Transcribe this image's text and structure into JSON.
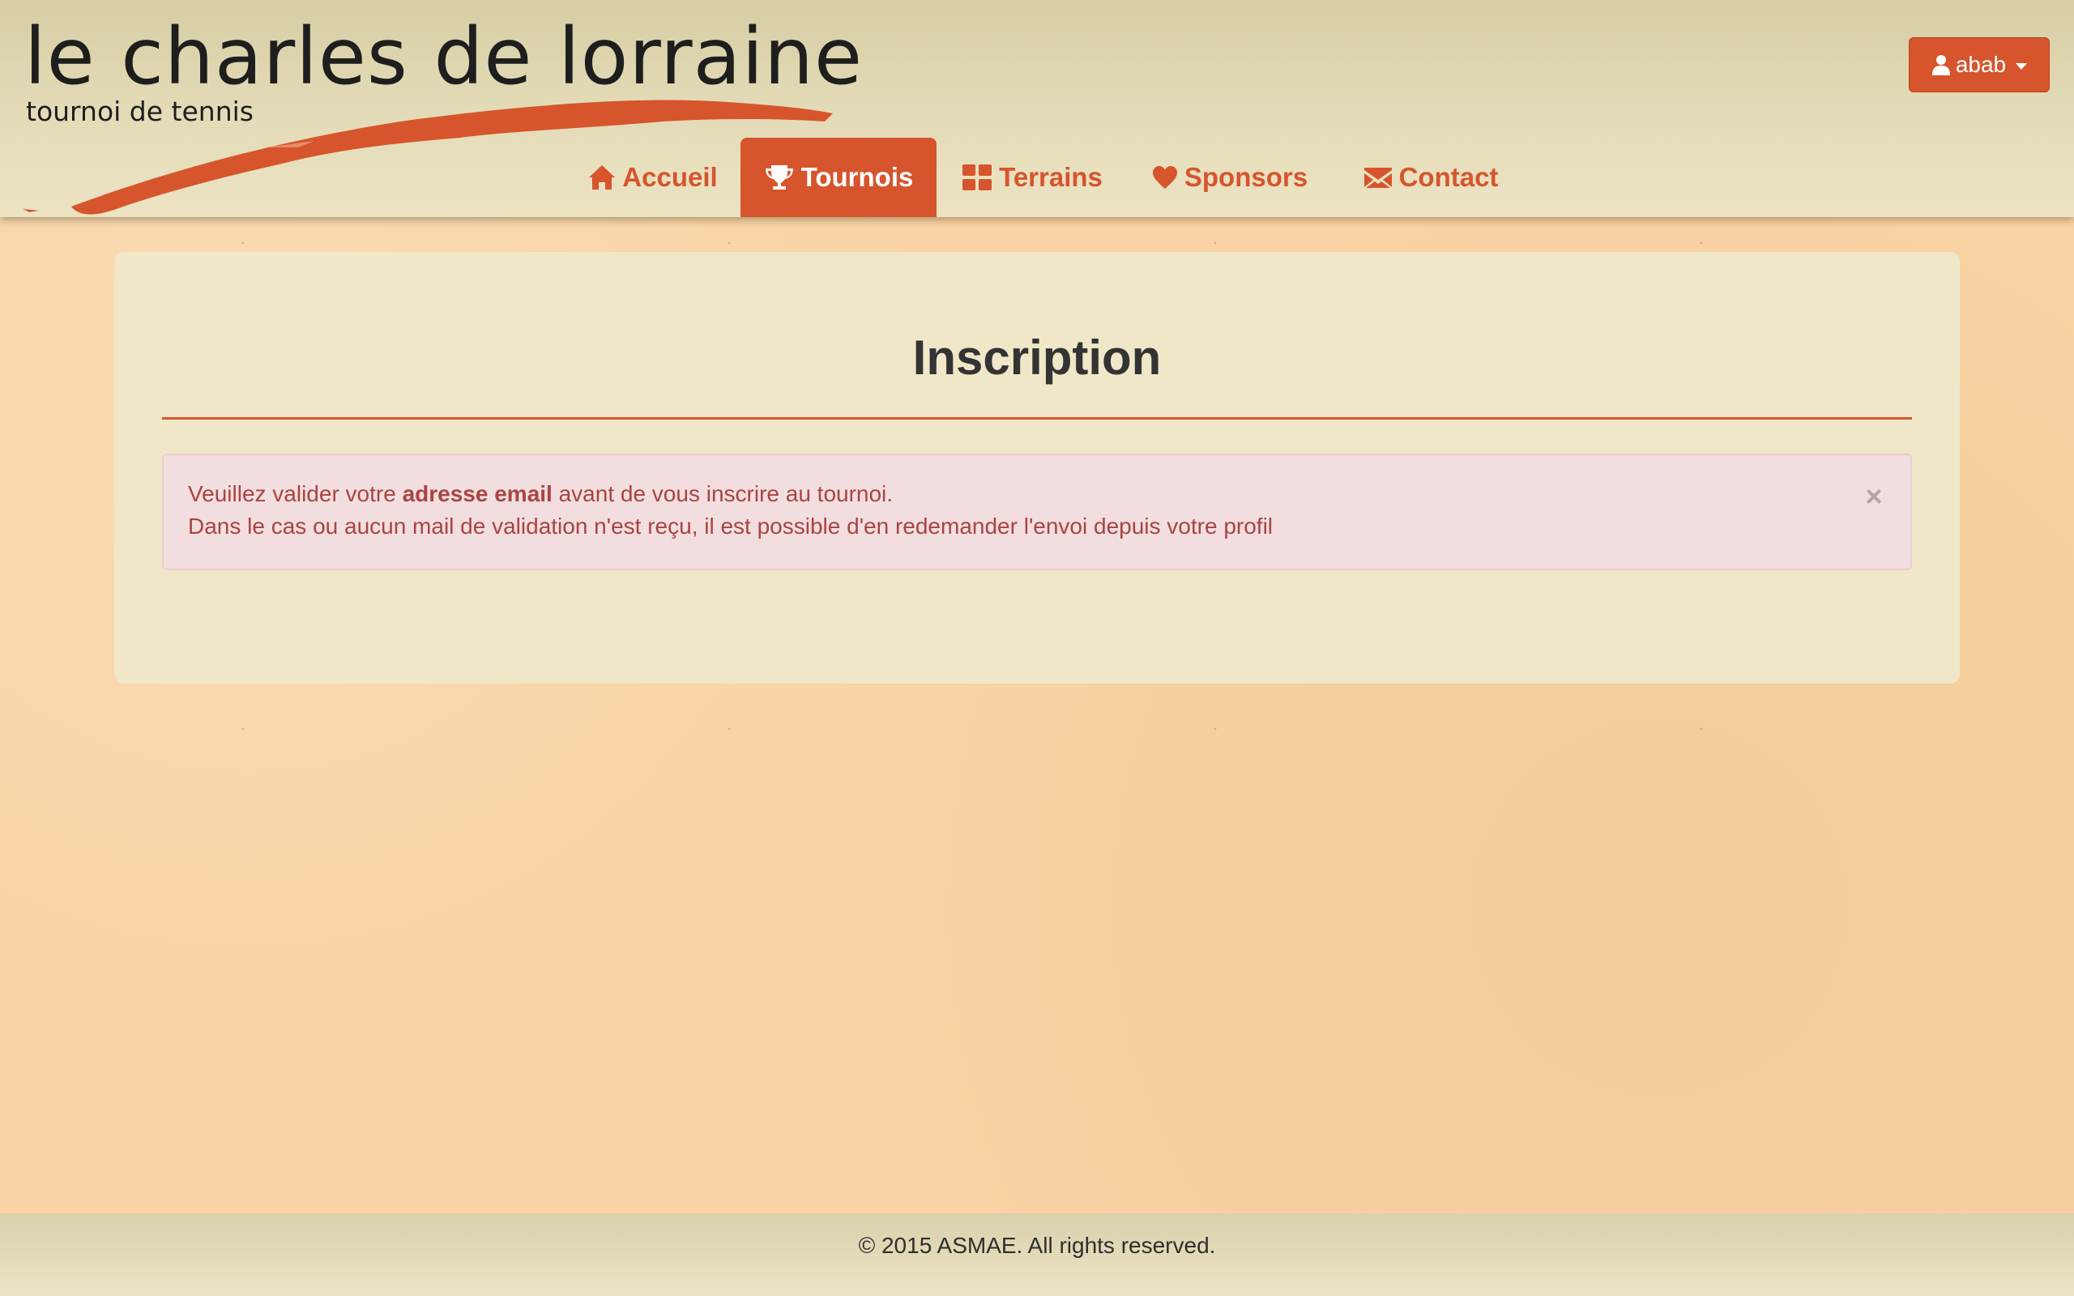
{
  "colors": {
    "brand": "#d6552d",
    "header_bg": "#e2dab5",
    "page_bg": "#f9d3a3",
    "panel_bg": "#f0e7c9",
    "alert_bg": "#f2dede",
    "alert_text": "#a94442"
  },
  "logo": {
    "title": "le charles de lorraine",
    "subtitle": "tournoi de tennis"
  },
  "user_menu": {
    "icon": "user-icon",
    "label": "abab"
  },
  "nav": {
    "items": [
      {
        "label": "Accueil",
        "icon": "home-icon",
        "active": false
      },
      {
        "label": "Tournois",
        "icon": "trophy-icon",
        "active": true
      },
      {
        "label": "Terrains",
        "icon": "grid-icon",
        "active": false
      },
      {
        "label": "Sponsors",
        "icon": "heart-icon",
        "active": false
      },
      {
        "label": "Contact",
        "icon": "envelope-icon",
        "active": false
      }
    ]
  },
  "main": {
    "title": "Inscription",
    "alert": {
      "line1_before": "Veuillez valider votre ",
      "line1_bold": "adresse email",
      "line1_after": " avant de vous inscrire au tournoi.",
      "line2": "Dans le cas ou aucun mail de validation n'est reçu, il est possible d'en redemander l'envoi depuis votre profil",
      "close_label": "×"
    }
  },
  "footer": {
    "text": "© 2015 ASMAE. All rights reserved."
  }
}
